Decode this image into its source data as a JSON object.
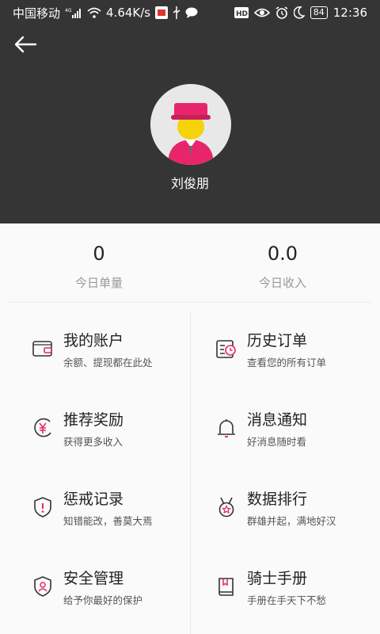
{
  "status": {
    "carrier": "中国移动",
    "network": "4G",
    "speed": "4.64K/s",
    "battery": "84",
    "time": "12:36"
  },
  "profile": {
    "name": "刘俊朋"
  },
  "stats": {
    "orders_value": "0",
    "orders_label": "今日单量",
    "income_value": "0.0",
    "income_label": "今日收入"
  },
  "menu": [
    {
      "title": "我的账户",
      "subtitle": "余额、提现都在此处",
      "icon": "wallet-icon"
    },
    {
      "title": "历史订单",
      "subtitle": "查看您的所有订单",
      "icon": "history-order-icon"
    },
    {
      "title": "推荐奖励",
      "subtitle": "获得更多收入",
      "icon": "yen-coin-icon"
    },
    {
      "title": "消息通知",
      "subtitle": "好消息随时看",
      "icon": "bell-icon"
    },
    {
      "title": "惩戒记录",
      "subtitle": "知错能改，善莫大焉",
      "icon": "warning-shield-icon"
    },
    {
      "title": "数据排行",
      "subtitle": "群雄并起，满地好汉",
      "icon": "medal-icon"
    },
    {
      "title": "安全管理",
      "subtitle": "给予你最好的保护",
      "icon": "security-shield-icon"
    },
    {
      "title": "骑士手册",
      "subtitle": "手册在手天下不愁",
      "icon": "handbook-icon"
    }
  ],
  "colors": {
    "header_bg": "#353535",
    "accent": "#e8256b",
    "avatar_face": "#f5d20a"
  }
}
